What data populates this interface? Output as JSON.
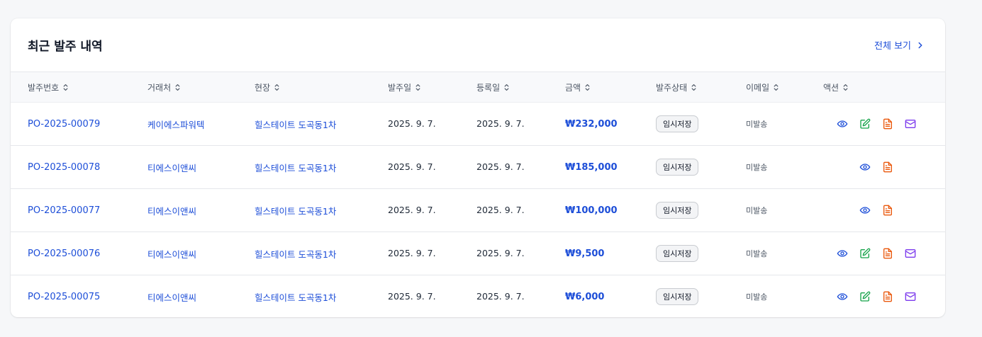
{
  "card": {
    "title": "최근 발주 내역",
    "view_all": "전체 보기"
  },
  "columns": [
    "발주번호",
    "거래처",
    "현장",
    "발주일",
    "등록일",
    "금액",
    "발주상태",
    "이메일",
    "액션"
  ],
  "rows": [
    {
      "po": "PO-2025-00079",
      "vendor": "케이에스파워텍",
      "site": "힐스테이트 도곡동1차",
      "order_date": "2025. 9. 7.",
      "reg_date": "2025. 9. 7.",
      "amount": "₩232,000",
      "status": "임시저장",
      "email": "미발송",
      "actions": [
        "view",
        "edit",
        "pdf",
        "mail"
      ]
    },
    {
      "po": "PO-2025-00078",
      "vendor": "티에스이앤씨",
      "site": "힐스테이트 도곡동1차",
      "order_date": "2025. 9. 7.",
      "reg_date": "2025. 9. 7.",
      "amount": "₩185,000",
      "status": "임시저장",
      "email": "미발송",
      "actions": [
        "view",
        "pdf"
      ]
    },
    {
      "po": "PO-2025-00077",
      "vendor": "티에스이앤씨",
      "site": "힐스테이트 도곡동1차",
      "order_date": "2025. 9. 7.",
      "reg_date": "2025. 9. 7.",
      "amount": "₩100,000",
      "status": "임시저장",
      "email": "미발송",
      "actions": [
        "view",
        "pdf"
      ]
    },
    {
      "po": "PO-2025-00076",
      "vendor": "티에스이앤씨",
      "site": "힐스테이트 도곡동1차",
      "order_date": "2025. 9. 7.",
      "reg_date": "2025. 9. 7.",
      "amount": "₩9,500",
      "status": "임시저장",
      "email": "미발송",
      "actions": [
        "view",
        "edit",
        "pdf",
        "mail"
      ]
    },
    {
      "po": "PO-2025-00075",
      "vendor": "티에스이앤씨",
      "site": "힐스테이트 도곡동1차",
      "order_date": "2025. 9. 7.",
      "reg_date": "2025. 9. 7.",
      "amount": "₩6,000",
      "status": "임시저장",
      "email": "미발송",
      "actions": [
        "view",
        "edit",
        "pdf",
        "mail"
      ]
    }
  ],
  "icons": {
    "view": {
      "name": "eye-icon",
      "color": "#1d4ed8"
    },
    "edit": {
      "name": "edit-icon",
      "color": "#16a34a"
    },
    "pdf": {
      "name": "document-icon",
      "color": "#ea580c"
    },
    "mail": {
      "name": "mail-icon",
      "color": "#7c3aed"
    }
  }
}
